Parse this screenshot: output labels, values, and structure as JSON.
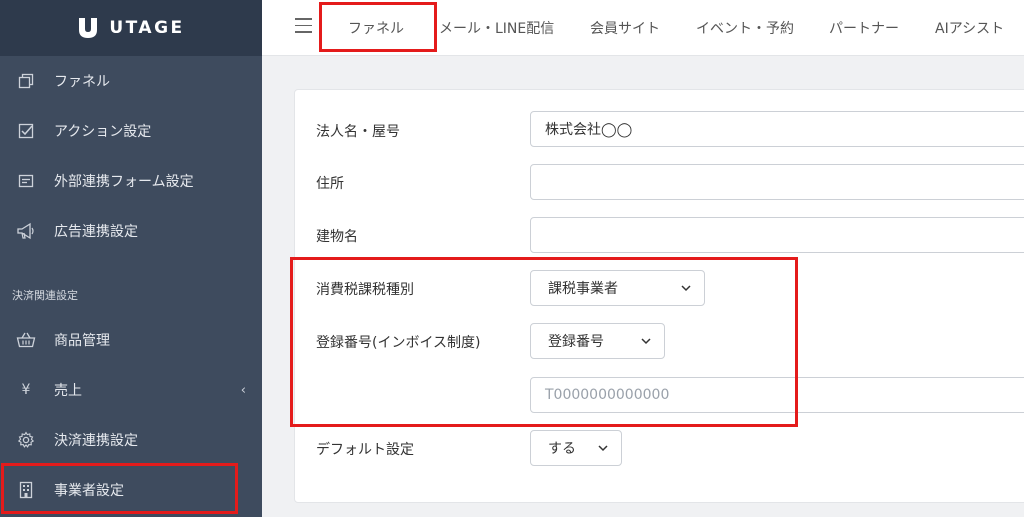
{
  "brand": {
    "name": "UTAGE"
  },
  "sidebar": {
    "items": [
      {
        "label": "ファネル",
        "icon": "copy-icon"
      },
      {
        "label": "アクション設定",
        "icon": "checkbox-icon"
      },
      {
        "label": "外部連携フォーム設定",
        "icon": "form-icon"
      },
      {
        "label": "広告連携設定",
        "icon": "megaphone-icon"
      }
    ],
    "section_title": "決済関連設定",
    "payment_items": [
      {
        "label": "商品管理",
        "icon": "basket-icon"
      },
      {
        "label": "売上",
        "icon": "yen-icon"
      },
      {
        "label": "決済連携設定",
        "icon": "gear-icon"
      },
      {
        "label": "事業者設定",
        "icon": "building-icon"
      }
    ],
    "yen_glyph": "¥",
    "expand_glyph": "‹"
  },
  "topbar": {
    "tabs": [
      "ファネル",
      "メール・LINE配信",
      "会員サイト",
      "イベント・予約",
      "パートナー",
      "AIアシスト"
    ]
  },
  "form": {
    "company_label": "法人名・屋号",
    "company_value": "株式会社◯◯",
    "address_label": "住所",
    "address_value": "",
    "building_label": "建物名",
    "building_value": "",
    "tax_type_label": "消費税課税種別",
    "tax_type_value": "課税事業者",
    "invoice_label": "登録番号(インボイス制度)",
    "invoice_select_value": "登録番号",
    "invoice_placeholder": "T0000000000000",
    "default_label": "デフォルト設定",
    "default_value": "する"
  },
  "colors": {
    "highlight": "#e41b1b",
    "sidebar": "#3e4b5e",
    "sidebar_header": "#2e3a4c"
  }
}
